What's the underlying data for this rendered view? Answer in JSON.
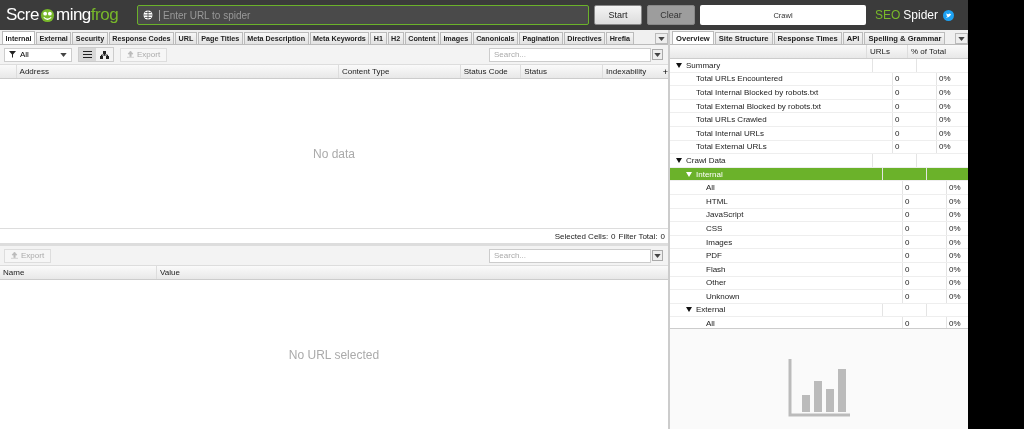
{
  "header": {
    "logo": [
      "Scre",
      "ming",
      "frog"
    ],
    "url_field": {
      "placeholder": "Enter URL to spider"
    },
    "buttons": [
      {
        "label": "Start",
        "kind": "start"
      },
      {
        "label": "Clear",
        "kind": "clear"
      }
    ],
    "mode_field": {
      "value": "Crawl"
    },
    "brand": [
      "SEO",
      "Spider"
    ]
  },
  "left_tabs": [
    {
      "label": "Internal",
      "selected": true
    },
    {
      "label": "External",
      "selected": false
    },
    {
      "label": "Security",
      "selected": false
    },
    {
      "label": "Response Codes",
      "selected": false
    },
    {
      "label": "URL",
      "selected": false
    },
    {
      "label": "Page Titles",
      "selected": false
    },
    {
      "label": "Meta Description",
      "selected": false
    },
    {
      "label": "Meta Keywords",
      "selected": false
    },
    {
      "label": "H1",
      "selected": false
    },
    {
      "label": "H2",
      "selected": false
    },
    {
      "label": "Content",
      "selected": false
    },
    {
      "label": "Images",
      "selected": false
    },
    {
      "label": "Canonicals",
      "selected": false
    },
    {
      "label": "Pagination",
      "selected": false
    },
    {
      "label": "Directives",
      "selected": false
    },
    {
      "label": "Hrefla",
      "selected": false
    }
  ],
  "main_toolbar": {
    "filter": "All",
    "views": [
      {
        "kind": "list",
        "selected": true
      },
      {
        "kind": "tree",
        "selected": false
      }
    ],
    "export": "Export",
    "search": {
      "placeholder": "Search..."
    }
  },
  "main_table": {
    "columns": [
      "Address",
      "Content Type",
      "Status Code",
      "Status",
      "Indexability"
    ],
    "add_column": "+",
    "empty": "No data"
  },
  "status_bar": {
    "selected_cells": "Selected Cells:",
    "selected_count": "0",
    "filter_total": "Filter Total:",
    "filter_count": "0"
  },
  "details_toolbar": {
    "export": "Export",
    "search": {
      "placeholder": "Search..."
    }
  },
  "details_table": {
    "columns": [
      "Name",
      "Value"
    ],
    "empty": "No URL selected"
  },
  "right_tabs": [
    {
      "label": "Overview",
      "selected": true
    },
    {
      "label": "Site Structure",
      "selected": false
    },
    {
      "label": "Response Times",
      "selected": false
    },
    {
      "label": "API",
      "selected": false
    },
    {
      "label": "Spelling & Grammar",
      "selected": false
    }
  ],
  "overview": {
    "columns": [
      "URLs",
      "% of Total"
    ],
    "rows": [
      {
        "label": "Summary",
        "expanded": true,
        "selected": false,
        "children": [
          {
            "label": "Total URLs Encountered",
            "urls": "0",
            "percent": "0%",
            "selected": false
          },
          {
            "label": "Total Internal Blocked by robots.txt",
            "urls": "0",
            "percent": "0%",
            "selected": false
          },
          {
            "label": "Total External Blocked by robots.txt",
            "urls": "0",
            "percent": "0%",
            "selected": false
          },
          {
            "label": "Total URLs Crawled",
            "urls": "0",
            "percent": "0%",
            "selected": false
          },
          {
            "label": "Total Internal URLs",
            "urls": "0",
            "percent": "0%",
            "selected": false
          },
          {
            "label": "Total External URLs",
            "urls": "0",
            "percent": "0%",
            "selected": false
          }
        ]
      },
      {
        "label": "Crawl Data",
        "expanded": true,
        "selected": false,
        "children": [
          {
            "label": "Internal",
            "expanded": true,
            "selected": true,
            "children": [
              {
                "label": "All",
                "urls": "0",
                "percent": "0%",
                "selected": false
              },
              {
                "label": "HTML",
                "urls": "0",
                "percent": "0%",
                "selected": false
              },
              {
                "label": "JavaScript",
                "urls": "0",
                "percent": "0%",
                "selected": false
              },
              {
                "label": "CSS",
                "urls": "0",
                "percent": "0%",
                "selected": false
              },
              {
                "label": "Images",
                "urls": "0",
                "percent": "0%",
                "selected": false
              },
              {
                "label": "PDF",
                "urls": "0",
                "percent": "0%",
                "selected": false
              },
              {
                "label": "Flash",
                "urls": "0",
                "percent": "0%",
                "selected": false
              },
              {
                "label": "Other",
                "urls": "0",
                "percent": "0%",
                "selected": false
              },
              {
                "label": "Unknown",
                "urls": "0",
                "percent": "0%",
                "selected": false
              }
            ]
          },
          {
            "label": "External",
            "expanded": true,
            "selected": false,
            "children": [
              {
                "label": "All",
                "urls": "0",
                "percent": "0%",
                "selected": false
              }
            ]
          }
        ]
      }
    ]
  }
}
